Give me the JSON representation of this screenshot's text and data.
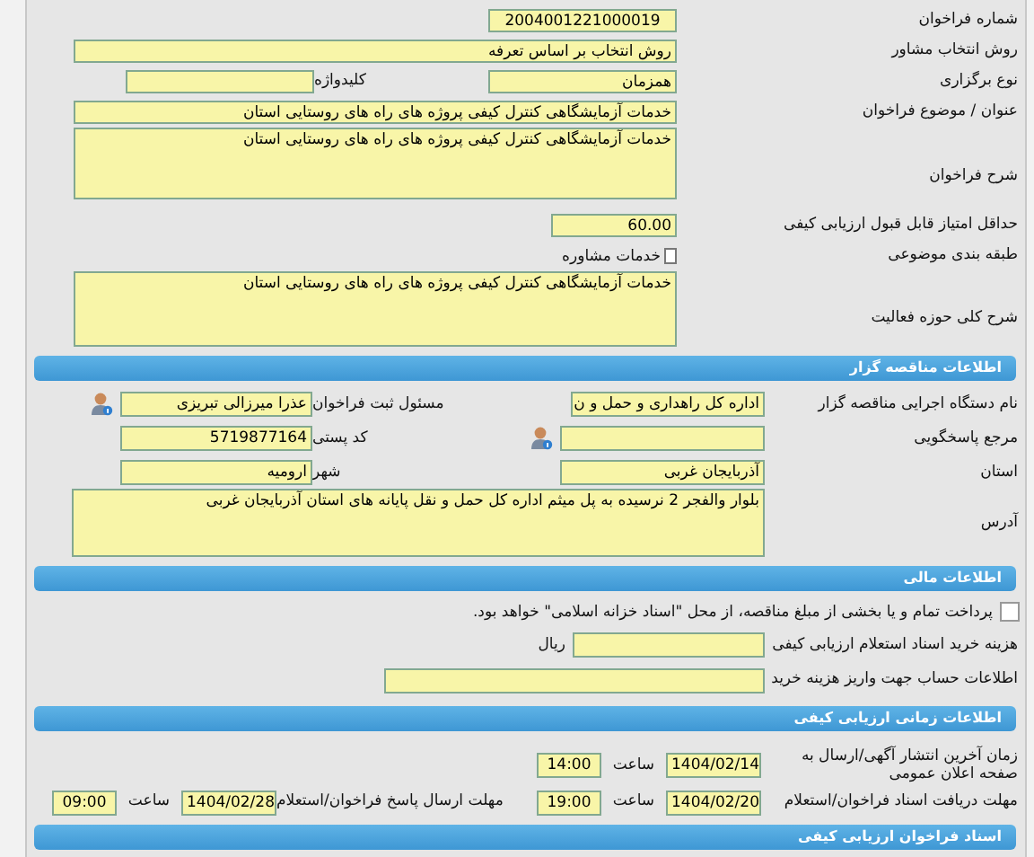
{
  "call": {
    "number": {
      "label": "شماره فراخوان",
      "value": "2004001221000019"
    },
    "selection_method": {
      "label": "روش انتخاب مشاور",
      "value": "روش انتخاب بر اساس تعرفه"
    },
    "holding_type": {
      "label": "نوع برگزاری",
      "value": "همزمان"
    },
    "keyword": {
      "label": "کلیدواژه"
    },
    "subject": {
      "label": "عنوان / موضوع فراخوان",
      "value": "خدمات آزمایشگاهی کنترل کیفی پروژه های راه های روستایی استان"
    },
    "description": {
      "label": "شرح فراخوان",
      "value": "خدمات آزمایشگاهی کنترل کیفی پروژه های راه های روستایی استان"
    },
    "min_score": {
      "label": "حداقل امتیاز قابل قبول ارزیابی کیفی",
      "value": "60.00"
    },
    "category": {
      "label": "طبقه بندی موضوعی",
      "value": "خدمات مشاوره"
    },
    "activity_scope": {
      "label": "شرح کلی حوزه فعالیت",
      "value": "خدمات آزمایشگاهی کنترل کیفی پروژه های راه های روستایی استان"
    }
  },
  "tenderer": {
    "title": "اطلاعات مناقصه گزار",
    "agency": {
      "label": "نام دستگاه اجرایی مناقصه گزار",
      "value": "اداره کل راهداری و حمل و ن"
    },
    "registrar": {
      "label": "مسئول ثبت فراخوان",
      "value": "عذرا میرزالی تبریزی"
    },
    "contact": {
      "label": "مرجع پاسخگویی"
    },
    "postal_code": {
      "label": "کد پستی",
      "value": "5719877164"
    },
    "province": {
      "label": "استان",
      "value": "آذربایجان غربی"
    },
    "city": {
      "label": "شهر",
      "value": "ارومیه"
    },
    "address": {
      "label": "آدرس",
      "value": "بلوار والفجر 2 نرسیده به پل میثم اداره کل حمل و نقل پایانه های استان آذربایجان غربی"
    }
  },
  "financial": {
    "title": "اطلاعات مالی",
    "treasury_note": {
      "text": "پرداخت تمام و یا بخشی از مبلغ مناقصه، از محل \"اسناد خزانه اسلامی\" خواهد بود.",
      "checked": false
    },
    "fee": {
      "label": "هزینه خرید اسناد استعلام ارزیابی کیفی",
      "unit": "ریال"
    },
    "account": {
      "label": "اطلاعات حساب جهت واریز هزینه خرید"
    }
  },
  "schedule": {
    "title": "اطلاعات زمانی ارزیابی کیفی",
    "publish": {
      "label": "زمان آخرین انتشار آگهی/ارسال به صفحه اعلان عمومی",
      "date": "1404/02/14",
      "time_label": "ساعت",
      "time": "14:00"
    },
    "doc_deadline": {
      "label": "مهلت دریافت اسناد فراخوان/استعلام",
      "date": "1404/02/20",
      "time_label": "ساعت",
      "time": "19:00"
    },
    "reply_deadline": {
      "label": "مهلت ارسال پاسخ فراخوان/استعلام",
      "date": "1404/02/28",
      "time_label": "ساعت",
      "time": "09:00"
    }
  },
  "documents": {
    "title": "اسناد فراخوان ارزیابی کیفی"
  }
}
